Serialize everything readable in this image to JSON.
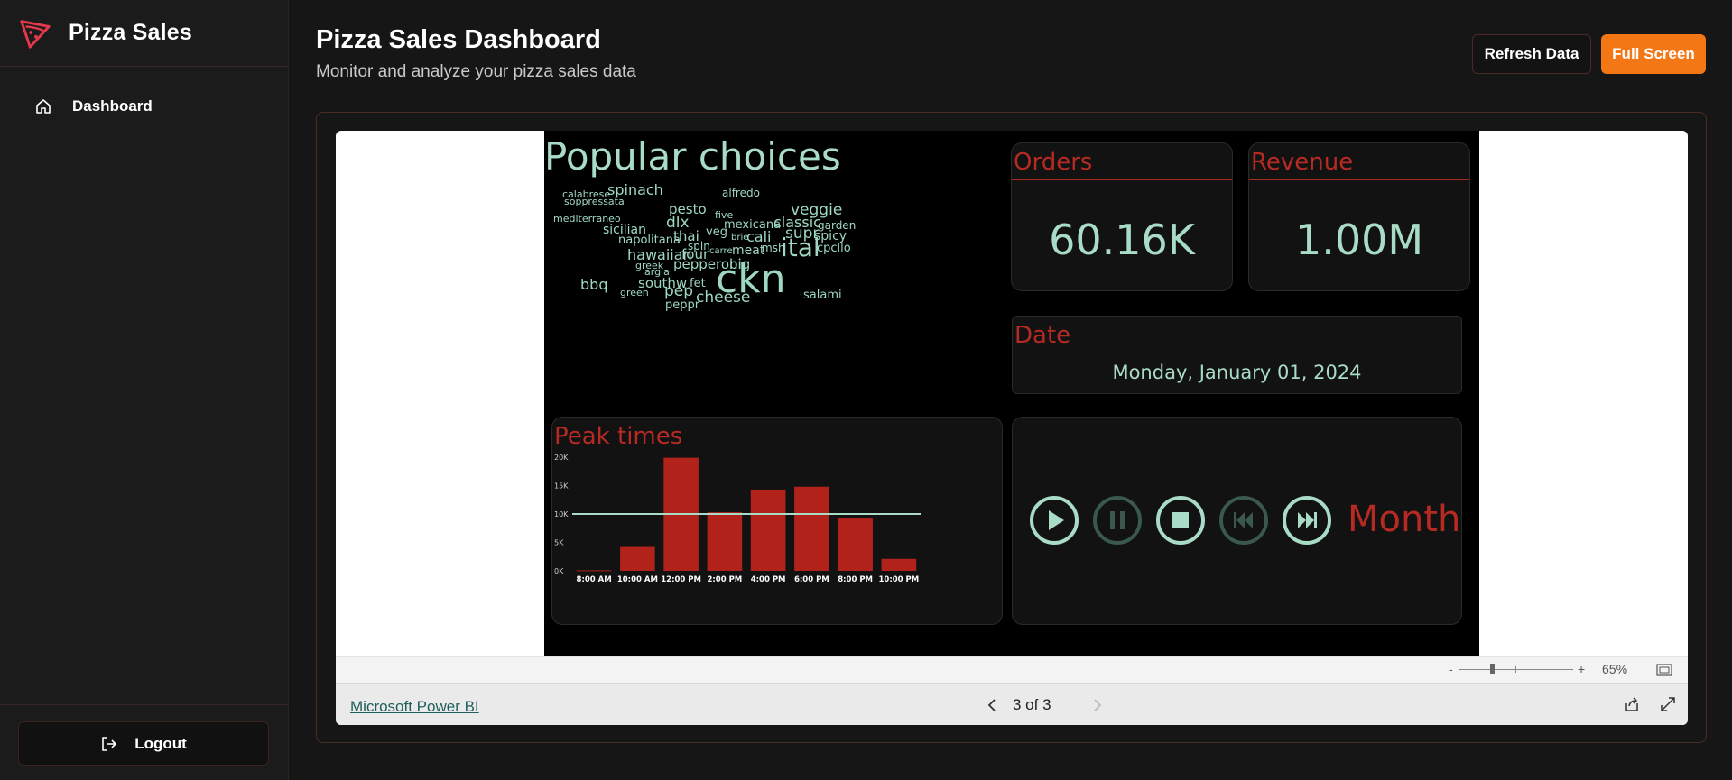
{
  "brand": {
    "name": "Pizza Sales",
    "logo_icon": "pizza-slice-icon",
    "accent": "#e5384a"
  },
  "sidebar": {
    "items": [
      {
        "label": "Dashboard",
        "icon": "home-icon",
        "active": true
      }
    ],
    "logout_label": "Logout"
  },
  "header": {
    "title": "Pizza Sales Dashboard",
    "subtitle": "Monitor and analyze your pizza sales data",
    "refresh_label": "Refresh Data",
    "fullscreen_label": "Full Screen",
    "fullscreen_color": "#f47716"
  },
  "report": {
    "wordcloud": {
      "title": "Popular choices",
      "words": [
        "calabrese",
        "spinach",
        "alfredo",
        "soppressata",
        "pesto",
        "five",
        "veggie",
        "mediterraneo",
        "dlx",
        "mexicana",
        "classic",
        "garden",
        "sicilian",
        "veg",
        "cali",
        "supr",
        "spicy",
        "napolitana",
        "thai",
        "brie",
        "msh",
        "cpcllo",
        "spin",
        "carre",
        "meat",
        "ital",
        "hawaiian",
        "four",
        "pepperoni",
        "greek",
        "big",
        "argla",
        "ckn",
        "southw",
        "fet",
        "bbq",
        "green",
        "pep",
        "cheese",
        "salami",
        "peppr"
      ]
    },
    "orders": {
      "title": "Orders",
      "value": "60.16K"
    },
    "revenue": {
      "title": "Revenue",
      "value": "1.00M"
    },
    "date": {
      "title": "Date",
      "value": "Monday, January 01, 2024"
    },
    "peak": {
      "title": "Peak times",
      "y_ticks": [
        "20K",
        "15K",
        "10K",
        "5K",
        "0K"
      ],
      "x_ticks": [
        "8:00 AM",
        "10:00 AM",
        "12:00 PM",
        "2:00 PM",
        "4:00 PM",
        "6:00 PM",
        "8:00 PM",
        "10:00 PM"
      ]
    },
    "player": {
      "label": "Month",
      "controls": [
        "play-icon",
        "pause-icon",
        "stop-icon",
        "previous-icon",
        "next-icon"
      ]
    },
    "zoom": {
      "minus": "-",
      "plus": "+",
      "value": "65%"
    },
    "footer": {
      "link": "Microsoft Power BI",
      "page": "3 of 3"
    }
  },
  "chart_data": {
    "type": "bar",
    "title": "Peak times",
    "categories": [
      "8:00 AM",
      "10:00 AM",
      "12:00 PM",
      "2:00 PM",
      "4:00 PM",
      "6:00 PM",
      "8:00 PM",
      "10:00 PM"
    ],
    "values": [
      100,
      4200,
      19900,
      10300,
      14300,
      14800,
      9300,
      2100
    ],
    "reference_line": 10000,
    "ylim": [
      0,
      20000
    ],
    "bar_color": "#b0221a",
    "line_color": "#a9dcc6"
  }
}
